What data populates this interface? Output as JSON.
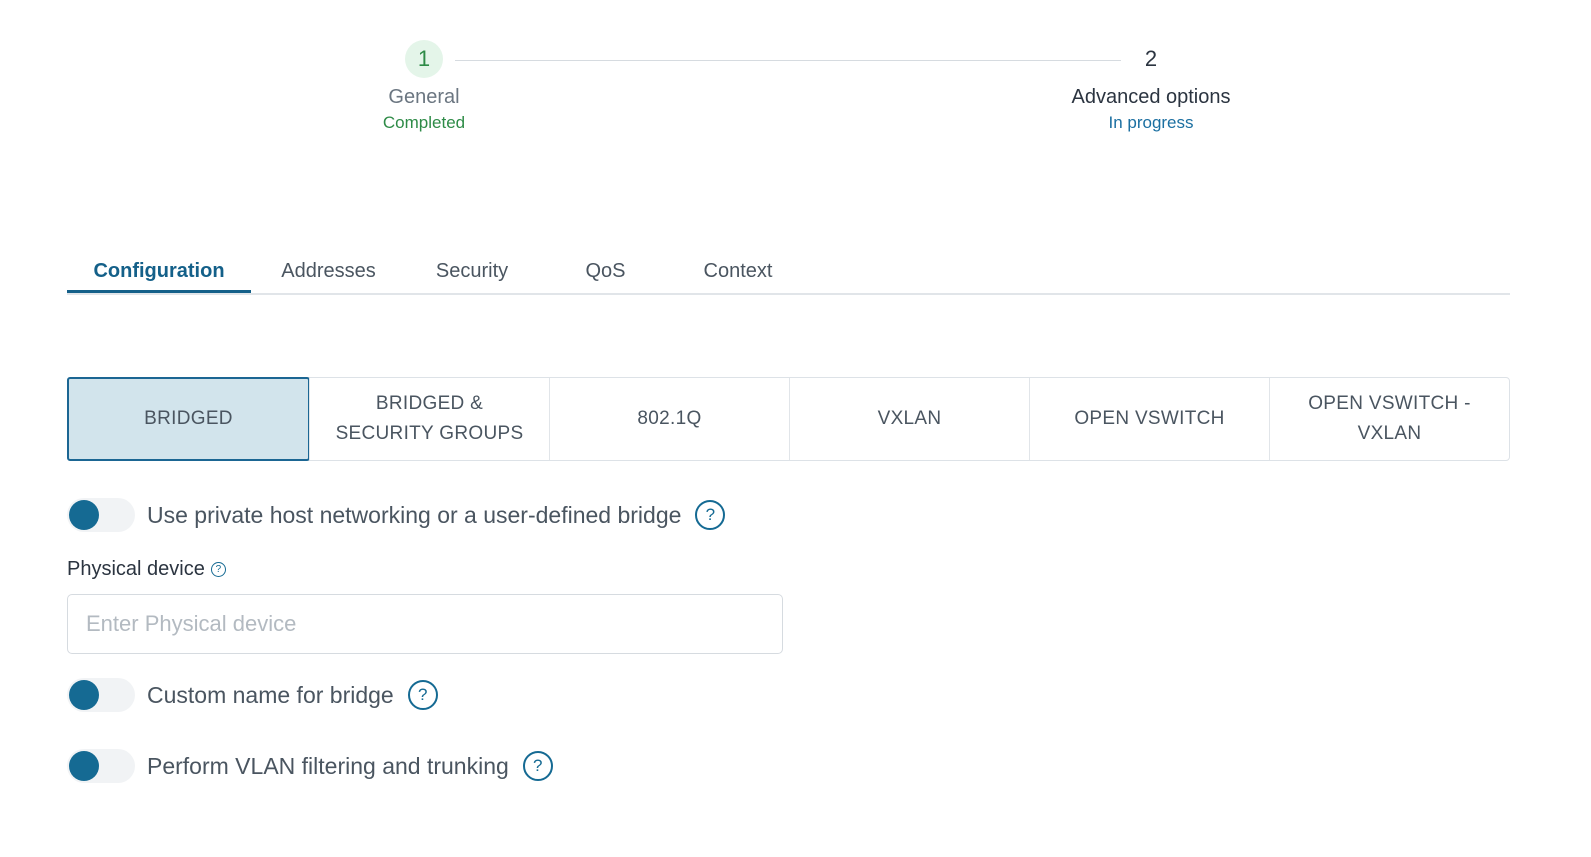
{
  "stepper": {
    "steps": [
      {
        "number": "1",
        "title": "General",
        "status": "Completed"
      },
      {
        "number": "2",
        "title": "Advanced options",
        "status": "In progress"
      }
    ]
  },
  "tabs": [
    {
      "label": "Configuration",
      "active": true
    },
    {
      "label": "Addresses"
    },
    {
      "label": "Security"
    },
    {
      "label": "QoS"
    },
    {
      "label": "Context"
    }
  ],
  "network_types": [
    {
      "label": "BRIDGED",
      "active": true
    },
    {
      "label": "BRIDGED & SECURITY GROUPS"
    },
    {
      "label": "802.1Q"
    },
    {
      "label": "VXLAN"
    },
    {
      "label": "OPEN VSWITCH"
    },
    {
      "label": "OPEN VSWITCH - VXLAN"
    }
  ],
  "toggles": {
    "private_host": {
      "label": "Use private host networking or a user-defined bridge",
      "help": "?"
    },
    "custom_name": {
      "label": "Custom name for bridge",
      "help": "?"
    },
    "vlan": {
      "label": "Perform VLAN filtering and trunking",
      "help": "?"
    }
  },
  "physical_device": {
    "label": "Physical device",
    "help": "?",
    "value": "",
    "placeholder": "Enter Physical device"
  },
  "colors": {
    "accent": "#146089",
    "completed": "#2e8b47",
    "in_progress": "#1b6fa1",
    "selected_segment_bg": "#d2e4ec"
  },
  "icons": {
    "help": "question-circle-icon"
  }
}
